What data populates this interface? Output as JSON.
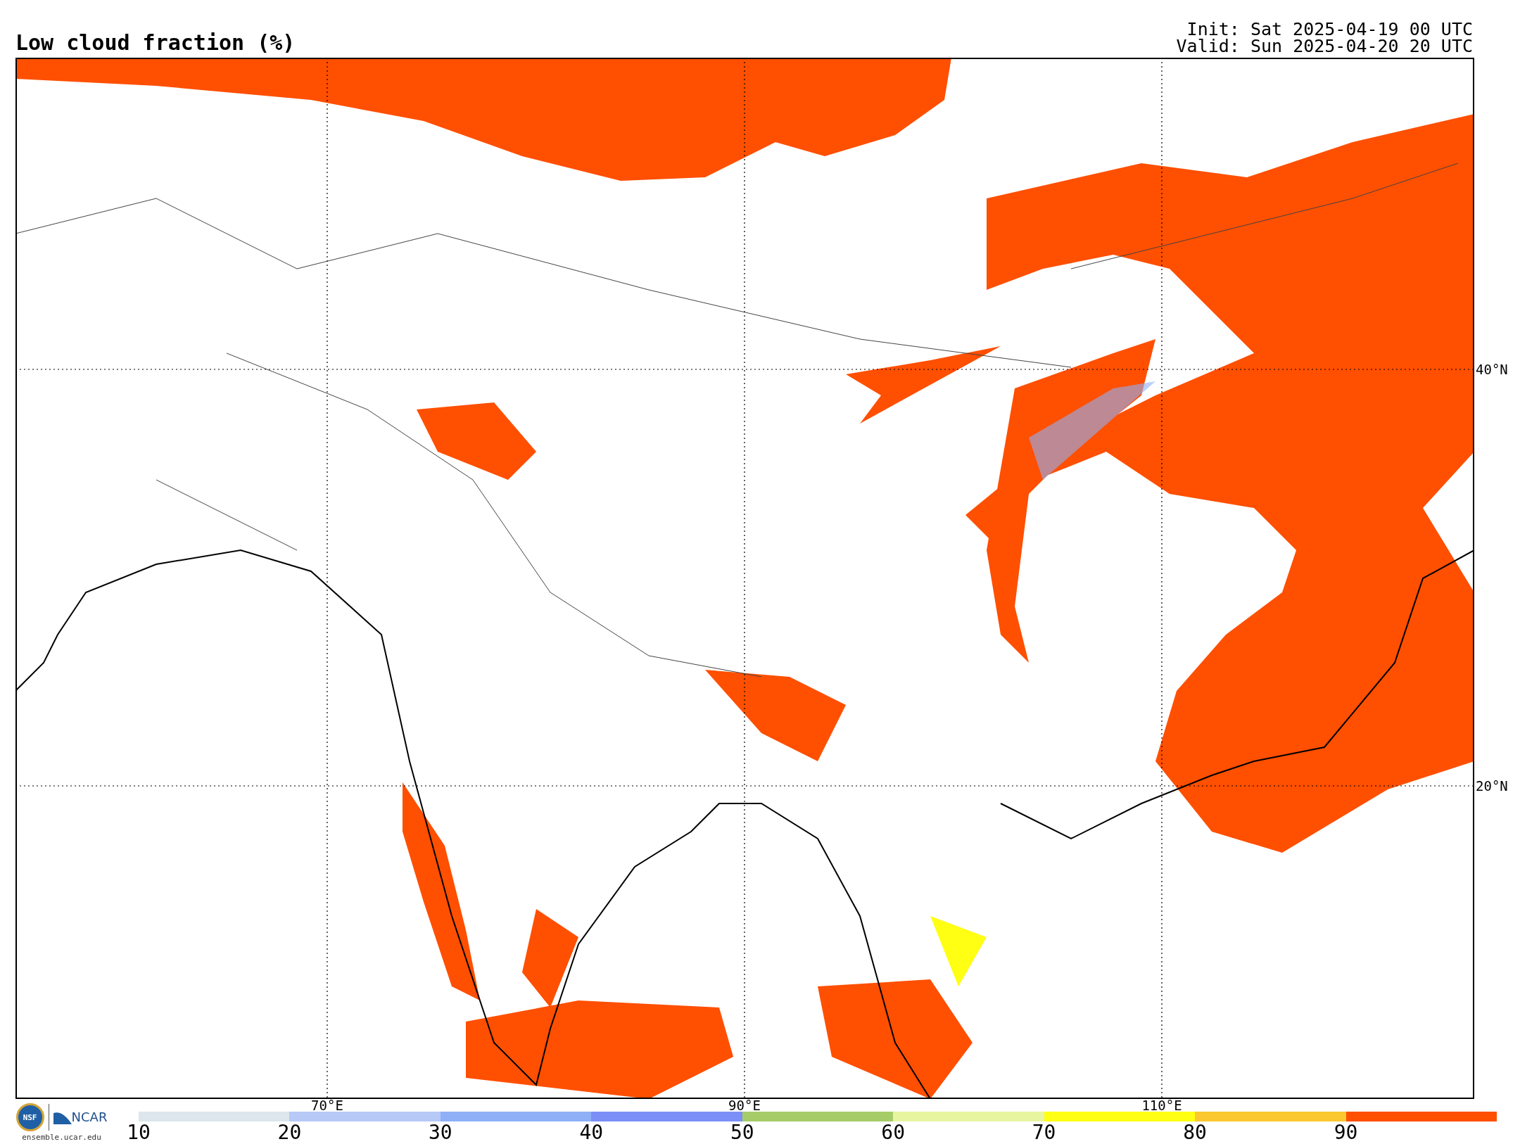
{
  "title": "Low cloud fraction (%)",
  "init": "Init: Sat 2025-04-19 00 UTC",
  "valid": "Valid: Sun 2025-04-20 20 UTC",
  "map": {
    "lat_labels": [
      "40°N",
      "20°N"
    ],
    "lon_labels": [
      "70°E",
      "90°E",
      "110°E"
    ]
  },
  "logo": {
    "nsf": "NSF",
    "ncar": "NCAR",
    "url": "ensemble.ucar.edu"
  },
  "colorbar": {
    "bins": [
      {
        "label": "10",
        "color": "#dce6ec"
      },
      {
        "label": "20",
        "color": "#b6c9f7"
      },
      {
        "label": "30",
        "color": "#8fb0f6"
      },
      {
        "label": "40",
        "color": "#7c8ff6"
      },
      {
        "label": "50",
        "color": "#a6cc68"
      },
      {
        "label": "60",
        "color": "#e8f5a0"
      },
      {
        "label": "70",
        "color": "#ffff14"
      },
      {
        "label": "80",
        "color": "#fcc830"
      },
      {
        "label": "90",
        "color": "#ff4f00"
      }
    ]
  }
}
